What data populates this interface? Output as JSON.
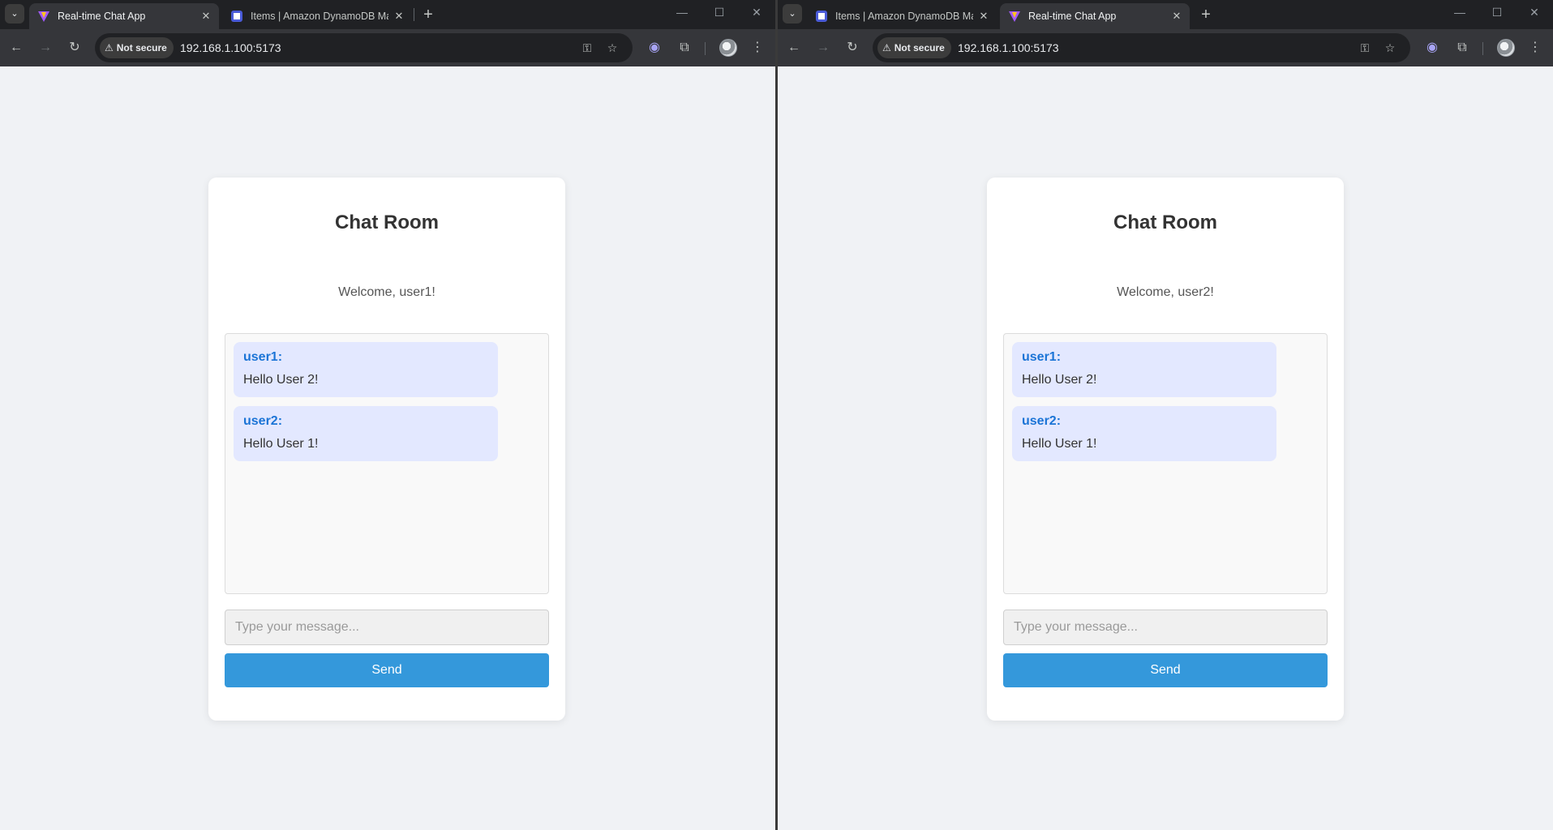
{
  "browser": {
    "url": "192.168.1.100:5173",
    "security_label": "Not secure",
    "tabs": {
      "chat_title": "Real-time Chat App",
      "dynamo_title": "Items | Amazon DynamoDB Ma"
    },
    "icons": {
      "tab_search": "chevron-down-icon",
      "back": "arrow-left-icon",
      "forward": "arrow-right-icon",
      "reload": "reload-icon",
      "password": "key-icon",
      "bookmark": "star-icon",
      "extension_ai": "brain-icon",
      "extensions": "puzzle-icon",
      "menu": "kebab-menu-icon"
    },
    "colors": {
      "chrome_dark": "#202124",
      "chrome_active": "#35363a",
      "page_bg": "#f0f2f5",
      "accent": "#3498db",
      "username": "#1b74d6",
      "message_bg": "#e3e8ff"
    }
  },
  "app": {
    "title": "Chat Room",
    "input_placeholder": "Type your message...",
    "send_label": "Send",
    "messages": [
      {
        "user": "user1:",
        "text": "Hello User 2!"
      },
      {
        "user": "user2:",
        "text": "Hello User 1!"
      }
    ]
  },
  "windows": [
    {
      "welcome": "Welcome, user1!"
    },
    {
      "welcome": "Welcome, user2!"
    }
  ]
}
